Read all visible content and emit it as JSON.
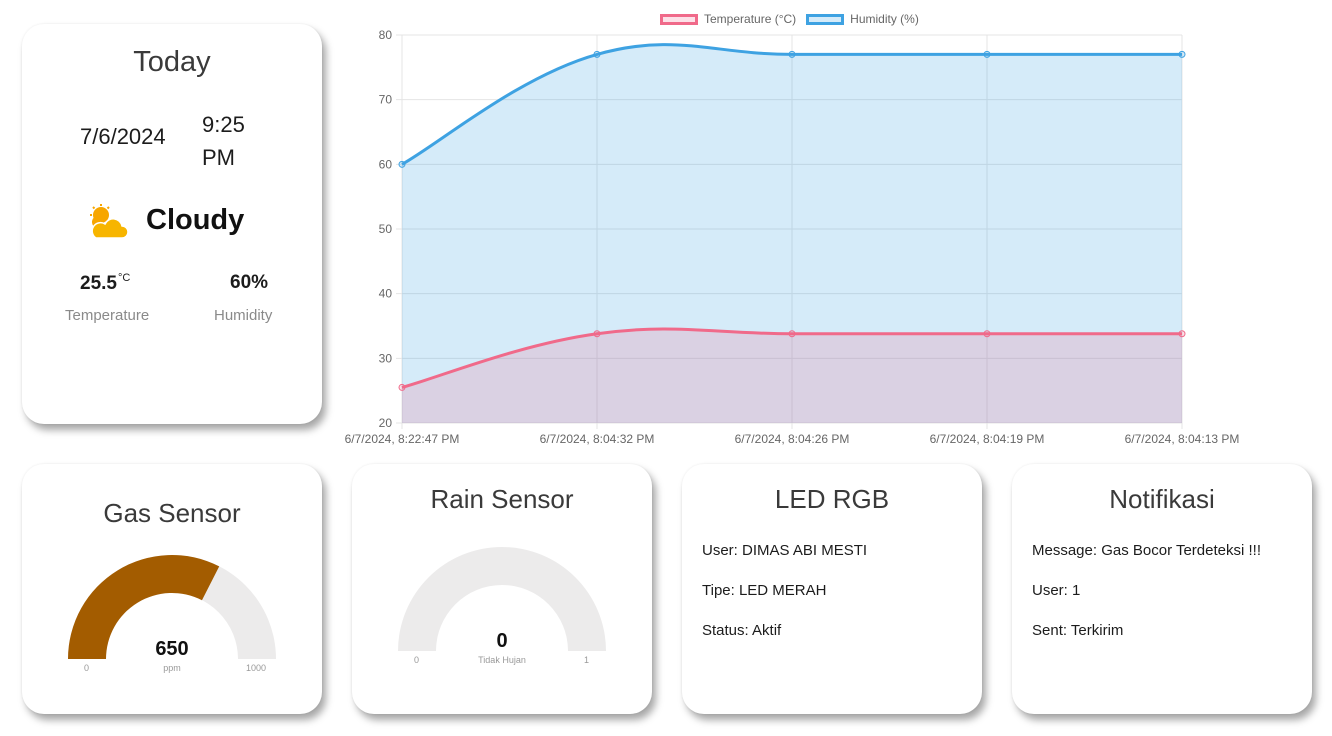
{
  "today": {
    "title": "Today",
    "date": "7/6/2024",
    "time": "9:25 PM",
    "condition": "Cloudy",
    "condition_icon": "cloudy-sun-icon",
    "temperature": "25.5",
    "temperature_unit": "°C",
    "temperature_label": "Temperature",
    "humidity": "60%",
    "humidity_label": "Humidity"
  },
  "chart_data": {
    "type": "line",
    "categories": [
      "6/7/2024, 8:22:47 PM",
      "6/7/2024, 8:04:32 PM",
      "6/7/2024, 8:04:26 PM",
      "6/7/2024, 8:04:19 PM",
      "6/7/2024, 8:04:13 PM"
    ],
    "series": [
      {
        "name": "Temperature (°C)",
        "values": [
          25.5,
          33.8,
          33.8,
          33.8,
          33.8
        ],
        "color": "#f06a8a",
        "fill": "rgba(240,106,138,0.2)"
      },
      {
        "name": "Humidity (%)",
        "values": [
          60,
          77,
          77,
          77,
          77
        ],
        "color": "#3ea2e2",
        "fill": "rgba(62,162,226,0.22)"
      }
    ],
    "ylim": [
      20,
      80
    ],
    "yticks": [
      20,
      30,
      40,
      50,
      60,
      70,
      80
    ],
    "grid": true,
    "legend": "top",
    "filled": true
  },
  "gas": {
    "title": "Gas Sensor",
    "value": 650,
    "value_text": "650",
    "unit": "ppm",
    "min": "0",
    "max": "1000",
    "fraction": 0.65,
    "color": "#a35c00",
    "track_color": "#ecebeb"
  },
  "rain": {
    "title": "Rain Sensor",
    "value": 0,
    "value_text": "0",
    "unit": "Tidak Hujan",
    "min": "0",
    "max": "1",
    "fraction": 0,
    "color": "#a35c00",
    "track_color": "#ecebeb"
  },
  "led": {
    "title": "LED RGB",
    "user": "User: DIMAS ABI MESTI",
    "type": "Tipe: LED MERAH",
    "status": "Status: Aktif"
  },
  "notif": {
    "title": "Notifikasi",
    "message": "Message: Gas Bocor Terdeteksi !!!",
    "user": "User: 1",
    "sent": "Sent: Terkirim"
  }
}
